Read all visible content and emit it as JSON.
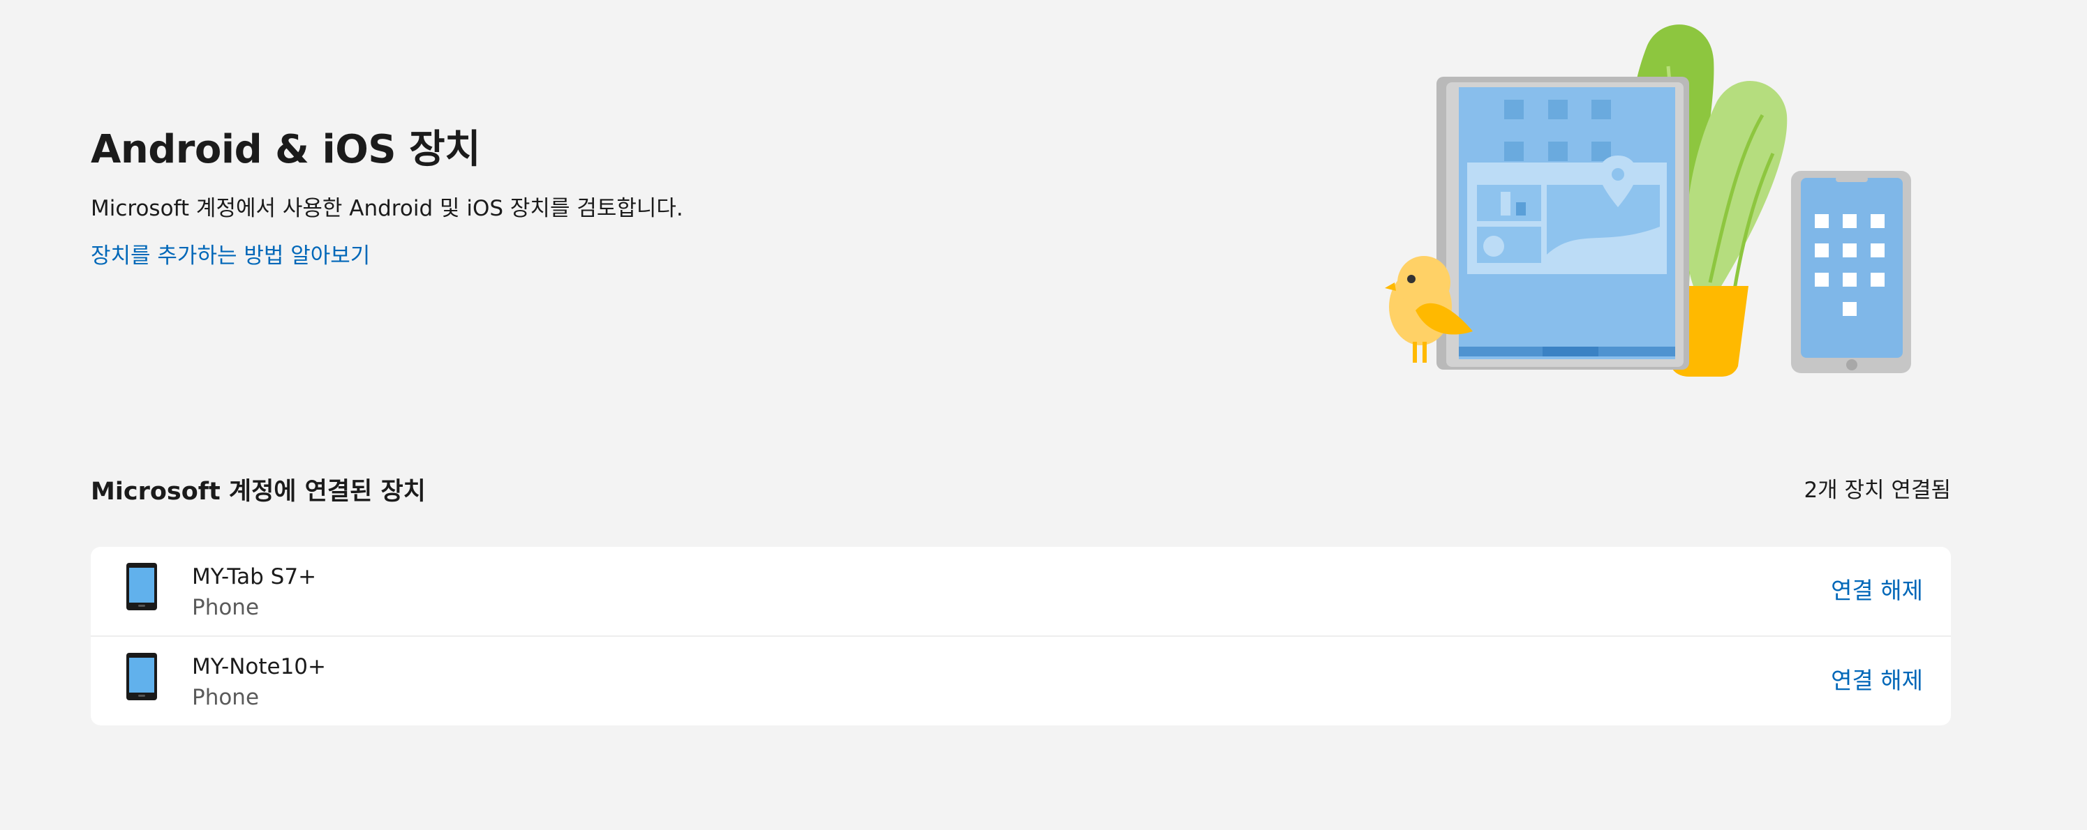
{
  "header": {
    "title": "Android & iOS 장치",
    "subtitle": "Microsoft 계정에서 사용한 Android 및 iOS 장치를 검토합니다.",
    "learn_link": "장치를 추가하는 방법 알아보기"
  },
  "section": {
    "title": "Microsoft 계정에 연결된 장치",
    "count": "2개 장치 연결됨"
  },
  "devices": [
    {
      "name": "MY-Tab S7+",
      "type": "Phone",
      "action": "연결 해제",
      "icon": "phone-icon"
    },
    {
      "name": "MY-Note10+",
      "type": "Phone",
      "action": "연결 해제",
      "icon": "phone-icon"
    }
  ],
  "colors": {
    "background": "#f3f3f3",
    "accent": "#0067b8",
    "card": "#ffffff"
  }
}
